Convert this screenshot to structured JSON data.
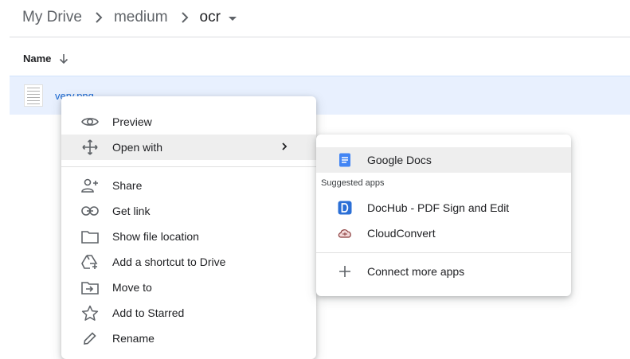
{
  "breadcrumb": {
    "items": [
      "My Drive",
      "medium"
    ],
    "current": "ocr"
  },
  "list": {
    "column_name": "Name",
    "file_name": "very.png"
  },
  "context_menu": {
    "items": [
      "Preview",
      "Open with",
      "Share",
      "Get link",
      "Show file location",
      "Add a shortcut to Drive",
      "Move to",
      "Add to Starred",
      "Rename"
    ]
  },
  "submenu": {
    "primary_app": "Google Docs",
    "section_title": "Suggested apps",
    "apps": [
      "DocHub - PDF Sign and Edit",
      "CloudConvert"
    ],
    "connect": "Connect more apps"
  },
  "colors": {
    "selected_row": "#e8f0fe",
    "hover": "#eeeeee",
    "google_docs_blue": "#4285f4",
    "dochub_blue": "#2b6fd6"
  },
  "icons": [
    "eye-icon",
    "move-arrows-icon",
    "chevron-right-icon",
    "person-add-icon",
    "link-icon",
    "folder-icon",
    "drive-shortcut-icon",
    "move-to-icon",
    "star-icon",
    "pencil-icon",
    "google-docs-icon",
    "dochub-icon",
    "cloudconvert-icon",
    "plus-icon",
    "sort-arrow-down-icon",
    "caret-down-icon"
  ]
}
